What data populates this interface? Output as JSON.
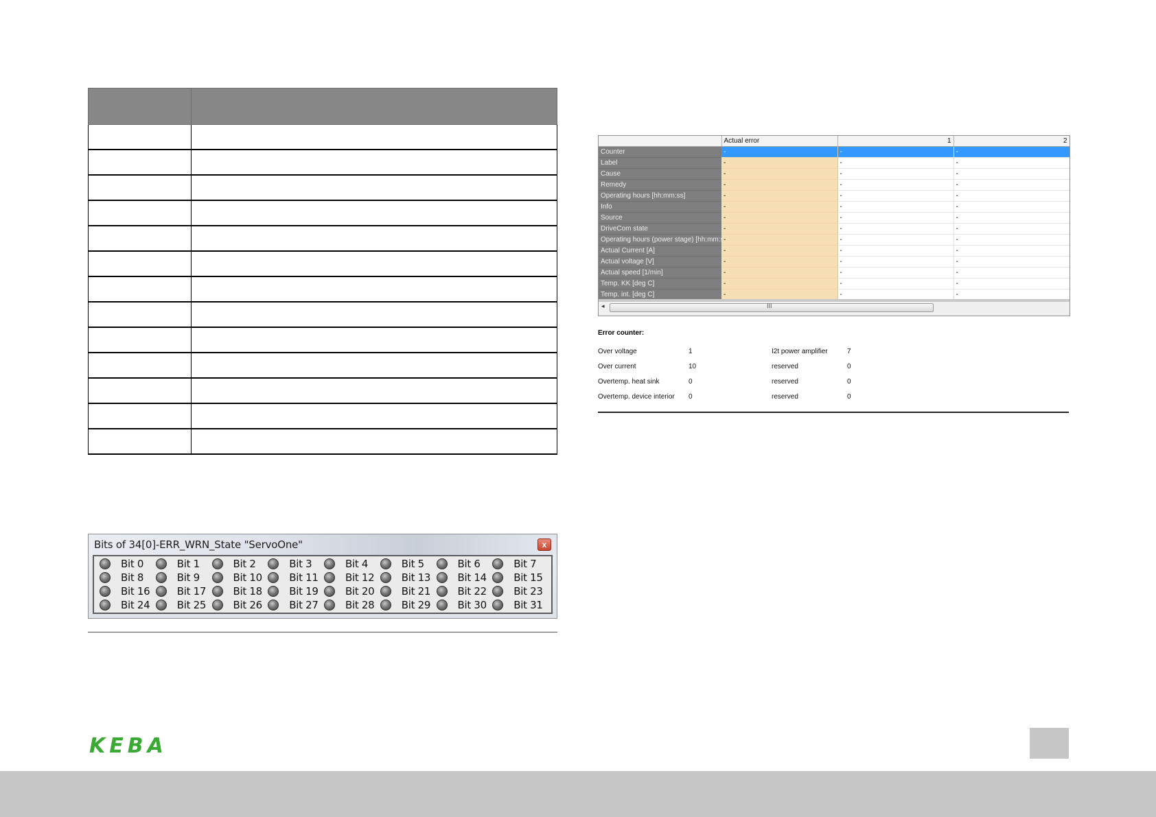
{
  "bits_window": {
    "title": "Bits of 34[0]-ERR_WRN_State \"ServoOne\"",
    "close_label": "x",
    "bits": [
      "Bit 0",
      "Bit 1",
      "Bit 2",
      "Bit 3",
      "Bit 4",
      "Bit 5",
      "Bit 6",
      "Bit 7",
      "Bit 8",
      "Bit 9",
      "Bit 10",
      "Bit 11",
      "Bit 12",
      "Bit 13",
      "Bit 14",
      "Bit 15",
      "Bit 16",
      "Bit 17",
      "Bit 18",
      "Bit 19",
      "Bit 20",
      "Bit 21",
      "Bit 22",
      "Bit 23",
      "Bit 24",
      "Bit 25",
      "Bit 26",
      "Bit 27",
      "Bit 28",
      "Bit 29",
      "Bit 30",
      "Bit 31"
    ]
  },
  "error_grid": {
    "columns": [
      "",
      "Actual error",
      "1",
      "2"
    ],
    "rows": [
      {
        "label": "Counter",
        "values": [
          "-",
          "-",
          "-"
        ]
      },
      {
        "label": "Label",
        "values": [
          "-",
          "-",
          "-"
        ]
      },
      {
        "label": "Cause",
        "values": [
          "-",
          "-",
          "-"
        ]
      },
      {
        "label": "Remedy",
        "values": [
          "-",
          "-",
          "-"
        ]
      },
      {
        "label": "Operating hours [hh:mm:ss]",
        "values": [
          "-",
          "-",
          "-"
        ]
      },
      {
        "label": "Info",
        "values": [
          "-",
          "-",
          "-"
        ]
      },
      {
        "label": "Source",
        "values": [
          "-",
          "-",
          "-"
        ]
      },
      {
        "label": "DriveCom state",
        "values": [
          "-",
          "-",
          "-"
        ]
      },
      {
        "label": "Operating hours (power stage) [hh:mm:ss]",
        "values": [
          "-",
          "-",
          "-"
        ]
      },
      {
        "label": "Actual Current  [A]",
        "values": [
          "-",
          "-",
          "-"
        ]
      },
      {
        "label": "Actual voltage  [V]",
        "values": [
          "-",
          "-",
          "-"
        ]
      },
      {
        "label": "Actual speed  [1/min]",
        "values": [
          "-",
          "-",
          "-"
        ]
      },
      {
        "label": "Temp. KK  [deg C]",
        "values": [
          "-",
          "-",
          "-"
        ]
      },
      {
        "label": "Temp. int.  [deg C]",
        "values": [
          "-",
          "-",
          "-"
        ]
      }
    ],
    "scroll_left": "◂",
    "scroll_grip": "III"
  },
  "error_counter": {
    "title": "Error counter:",
    "left": [
      {
        "label": "Over voltage",
        "value": "1"
      },
      {
        "label": "Over current",
        "value": "10"
      },
      {
        "label": "Overtemp. heat sink",
        "value": "0"
      },
      {
        "label": "Overtemp. device interior",
        "value": "0"
      }
    ],
    "right": [
      {
        "label": "I2t power amplifier",
        "value": "7"
      },
      {
        "label": "reserved",
        "value": "0"
      },
      {
        "label": "reserved",
        "value": "0"
      },
      {
        "label": "reserved",
        "value": "0"
      }
    ]
  },
  "logo_text": "KEBA",
  "colors": {
    "brand_green": "#3aaa35",
    "footer_gray": "#c6c6c6",
    "actual_error_bg": "#f7dfb5",
    "selection_blue": "#3399ff"
  }
}
